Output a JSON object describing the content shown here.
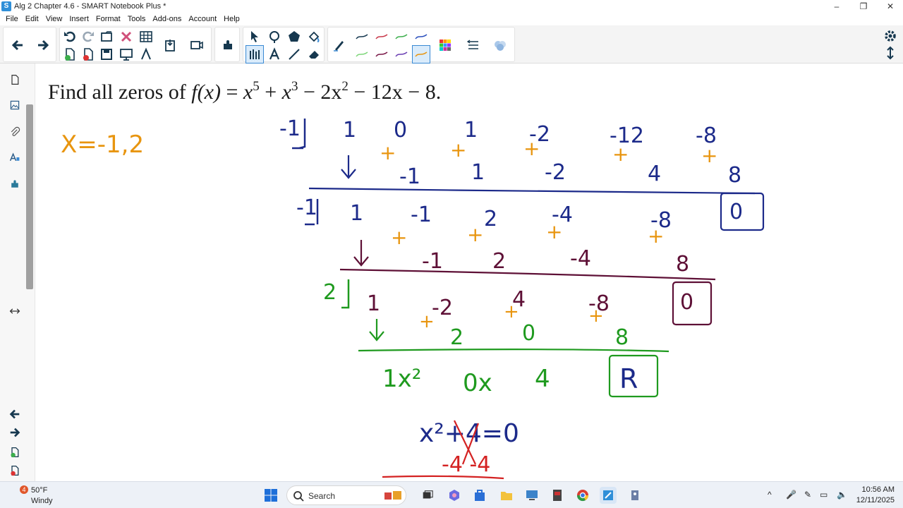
{
  "window": {
    "title": "Alg 2 Chapter 4.6 - SMART Notebook Plus *",
    "minimize": "–",
    "restore": "❐",
    "close": "✕"
  },
  "menu": [
    "File",
    "Edit",
    "View",
    "Insert",
    "Format",
    "Tools",
    "Add-ons",
    "Account",
    "Help"
  ],
  "toolbar": {
    "icons": [
      "back-arrow-icon",
      "forward-arrow-icon",
      "undo-icon",
      "redo-icon",
      "open-icon",
      "delete-icon",
      "table-icon",
      "new-page-icon",
      "delete-page-icon",
      "save-icon",
      "screen-shade-icon",
      "measurement-tools-icon",
      "paste-icon",
      "screen-capture-icon",
      "add-ons-icon",
      "select-icon",
      "pen-icon",
      "shapes-icon",
      "fill-icon",
      "pen-color-icon",
      "text-icon",
      "line-icon",
      "eraser-icon",
      "pen-style-icon",
      "line-styles-icon",
      "color-palette-icon",
      "line-properties-icon",
      "transparency-icon"
    ],
    "accent": "#3a8ad4"
  },
  "page": {
    "problem_prefix": "Find all zeros of",
    "problem_fx": "f(x)",
    "problem_eq": "=",
    "t1": "x",
    "e1": "5",
    "op1": "+",
    "t2": "x",
    "e2": "3",
    "op2": "−",
    "t3": "2x",
    "e3": "2",
    "op3": "−",
    "t4": "12x",
    "op4": "−",
    "t5": "8."
  },
  "ink": {
    "answer": "X=-1,2",
    "colors": {
      "blue": "#1c2a8a",
      "orange": "#e8950f",
      "maroon": "#5e1036",
      "green": "#1f9a1f",
      "red": "#d42222"
    },
    "row1_divisor": "-1",
    "row1": [
      "1",
      "0",
      "1",
      "-2",
      "-12",
      "-8"
    ],
    "row1_add": [
      "-1",
      "1",
      "-2",
      "4",
      "8"
    ],
    "row2_divisor": "-1",
    "row2": [
      "1",
      "-1",
      "2",
      "-4",
      "-8",
      "0"
    ],
    "row2_add": [
      "-1",
      "2",
      "-4",
      "8"
    ],
    "row3_divisor": "2",
    "row3": [
      "1",
      "-2",
      "4",
      "-8",
      "0"
    ],
    "row3_add": [
      "2",
      "0",
      "8"
    ],
    "quotient": [
      "1x²",
      "0x",
      "4",
      "R"
    ],
    "final_eq": "x²+4=0",
    "final_sub": "-4   -4"
  },
  "taskbar": {
    "weather_badge": "4",
    "temperature": "50°F",
    "condition": "Windy",
    "search": "Search",
    "time": "10:56 AM",
    "date": "12/11/2025"
  }
}
